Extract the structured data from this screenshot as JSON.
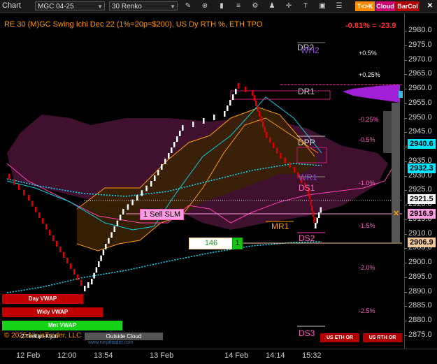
{
  "toolbar": {
    "title": "Chart",
    "instrument": "MGC 04-25",
    "bar_type": "30 Renko",
    "btn_tk": "T<>K",
    "btn_cloud": "Cloud",
    "btn_barcol": "BarCol",
    "icon_names": [
      "draw-icon",
      "zoom-in-icon",
      "bars-icon",
      "properties-icon",
      "settings-icon",
      "strategy-icon",
      "crosshair-icon",
      "text-icon",
      "lock-icon",
      "more-icon"
    ]
  },
  "header": {
    "description": "RE 30 (M)GC Swing Ichi Dec 22 (1%=20p=$200), US Dy RTH %, ETH TPO",
    "change": "-0.81% = -23.9"
  },
  "price_axis": {
    "ticks": [
      "2980.0",
      "2975.0",
      "2970.0",
      "2965.0",
      "2960.0",
      "2955.0",
      "2950.0",
      "2945.0",
      "2940.0",
      "2935.0",
      "2930.0",
      "2925.0",
      "2920.0",
      "2915.0",
      "2910.0",
      "2905.0",
      "2900.0",
      "2895.0",
      "2890.0",
      "2885.0",
      "2880.0",
      "2875.0"
    ],
    "tags": [
      {
        "text": "2940.6",
        "color": "#00e5ff"
      },
      {
        "text": "2932.3",
        "color": "#00e5ff"
      },
      {
        "text": "2921.5",
        "color": "#ffffff"
      },
      {
        "text": "2916.9",
        "color": "#ff9be0"
      },
      {
        "text": "2906.9",
        "color": "#f3c99a"
      }
    ]
  },
  "levels": {
    "dr2": "DR2",
    "wh2": "WH2",
    "dr1": "DR1",
    "dpp": "DPP",
    "wr1": "WR1",
    "ds1": "DS1",
    "mr1": "MR1",
    "ds2": "DS2",
    "ds3": "DS3"
  },
  "pct_levels": [
    "+0.5%",
    "+0.25%",
    "-0.25%",
    "-0.5%",
    "-1.0%",
    "-1.5%",
    "-2.0%",
    "-2.5%"
  ],
  "order": {
    "label": "1 Sell SLM",
    "qty_value": "146",
    "qty_count": "1"
  },
  "vwap": {
    "day": "Day VWAP",
    "wkly": "Wkly VWAP",
    "mnt": "Mnt VWAP"
  },
  "footer": {
    "copyright": "© 2025 NinjaTrader, LLC",
    "overlay": "2 Tenkan-Kijun",
    "outside_cloud": "Outside Cloud",
    "url": "www.ninjatrader.com",
    "us_eth": "US ETH OR",
    "us_rth": "US RTH OR"
  },
  "x_axis": [
    "12 Feb",
    "12:00",
    "13:54",
    "13 Feb",
    "14 Feb",
    "14:14",
    "15:32"
  ],
  "colors": {
    "accent_orange": "#ff9900",
    "cloud": "#5a1840",
    "ema_cyan": "#00e5ff",
    "bull": "#ffffff",
    "bear": "#e00000"
  }
}
